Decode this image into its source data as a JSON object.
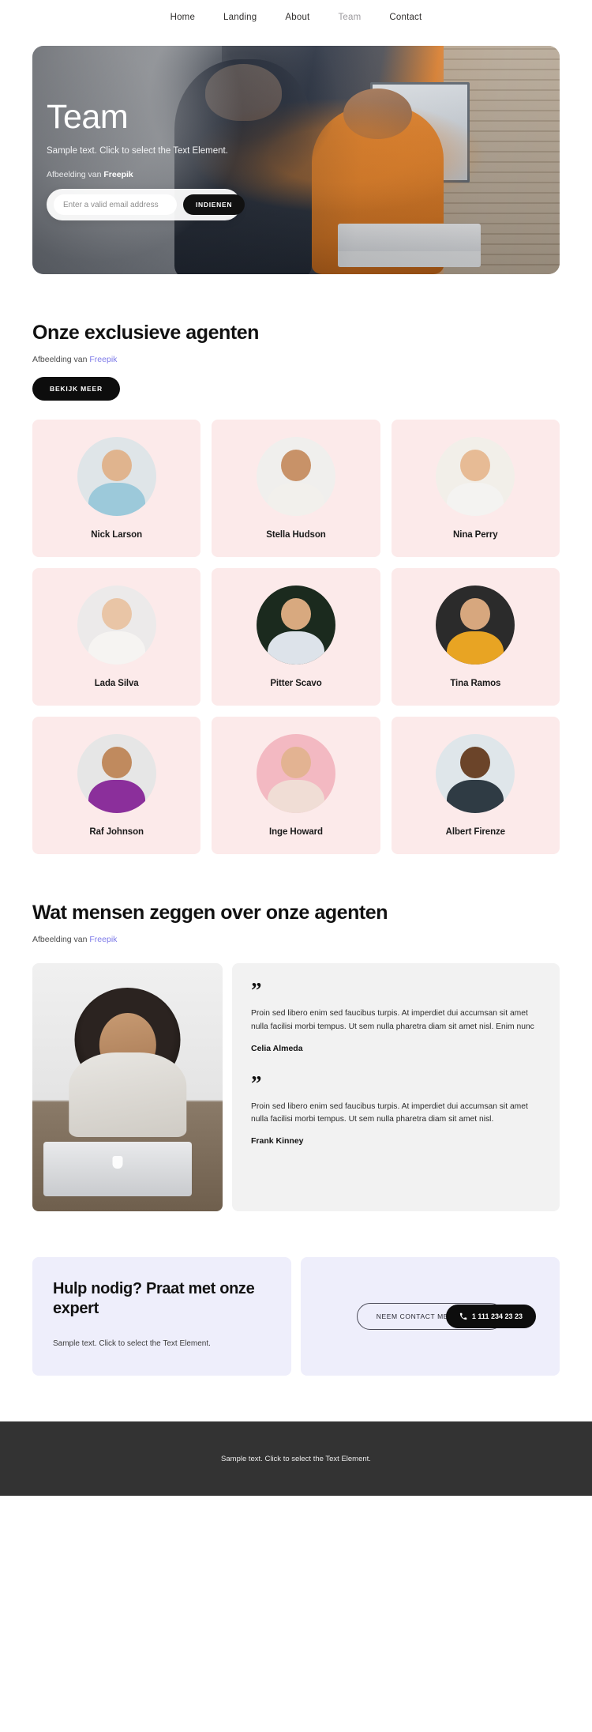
{
  "nav": {
    "items": [
      {
        "label": "Home",
        "active": false
      },
      {
        "label": "Landing",
        "active": false
      },
      {
        "label": "About",
        "active": false
      },
      {
        "label": "Team",
        "active": true
      },
      {
        "label": "Contact",
        "active": false
      }
    ]
  },
  "hero": {
    "title": "Team",
    "subtitle": "Sample text. Click to select the Text Element.",
    "credit_prefix": "Afbeelding van ",
    "credit_source": "Freepik",
    "email_placeholder": "Enter a valid email address",
    "email_value": "",
    "submit_label": "INDIENEN"
  },
  "agents": {
    "title": "Onze exclusieve agenten",
    "credit_prefix": "Afbeelding van ",
    "credit_link": "Freepik",
    "button_label": "BEKIJK MEER",
    "members": [
      {
        "name": "Nick Larson",
        "bg": "#dfe5e8",
        "skin": "#e0b48e",
        "cloth": "#9cc9da"
      },
      {
        "name": "Stella Hudson",
        "bg": "#f0efed",
        "skin": "#c89268",
        "cloth": "#f2f0ec"
      },
      {
        "name": "Nina Perry",
        "bg": "#f2efe9",
        "skin": "#e7bb95",
        "cloth": "#f4f3f1"
      },
      {
        "name": "Lada Silva",
        "bg": "#eceaea",
        "skin": "#e9c5a6",
        "cloth": "#f6f4f2"
      },
      {
        "name": "Pitter Scavo",
        "bg": "#1b2a1e",
        "skin": "#d8a97f",
        "cloth": "#dde3ea"
      },
      {
        "name": "Tina Ramos",
        "bg": "#2b2b2b",
        "skin": "#d7a77e",
        "cloth": "#e8a423"
      },
      {
        "name": "Raf Johnson",
        "bg": "#e6e6e6",
        "skin": "#c08a5e",
        "cloth": "#8b2f9b"
      },
      {
        "name": "Inge Howard",
        "bg": "#f3b9c2",
        "skin": "#e3b392",
        "cloth": "#f0ddd5"
      },
      {
        "name": "Albert Firenze",
        "bg": "#dfe6ea",
        "skin": "#6b4429",
        "cloth": "#2f3b44"
      }
    ]
  },
  "testimonials": {
    "title": "Wat mensen zeggen over onze agenten",
    "credit_prefix": "Afbeelding van ",
    "credit_link": "Freepik",
    "quote_glyph": "”",
    "items": [
      {
        "text": "Proin sed libero enim sed faucibus turpis. At imperdiet dui accumsan sit amet nulla facilisi morbi tempus. Ut sem nulla pharetra diam sit amet nisl. Enim nunc",
        "author": "Celia Almeda"
      },
      {
        "text": "Proin sed libero enim sed faucibus turpis. At imperdiet dui accumsan sit amet nulla facilisi morbi tempus. Ut sem nulla pharetra diam sit amet nisl.",
        "author": "Frank Kinney"
      }
    ]
  },
  "cta": {
    "title": "Hulp nodig? Praat met onze expert",
    "subtitle": "Sample text. Click to select the Text Element.",
    "contact_button": "NEEM CONTACT MET ONS OP",
    "phone": "1 111 234 23 23"
  },
  "footer": {
    "text": "Sample text. Click to select the Text Element."
  }
}
